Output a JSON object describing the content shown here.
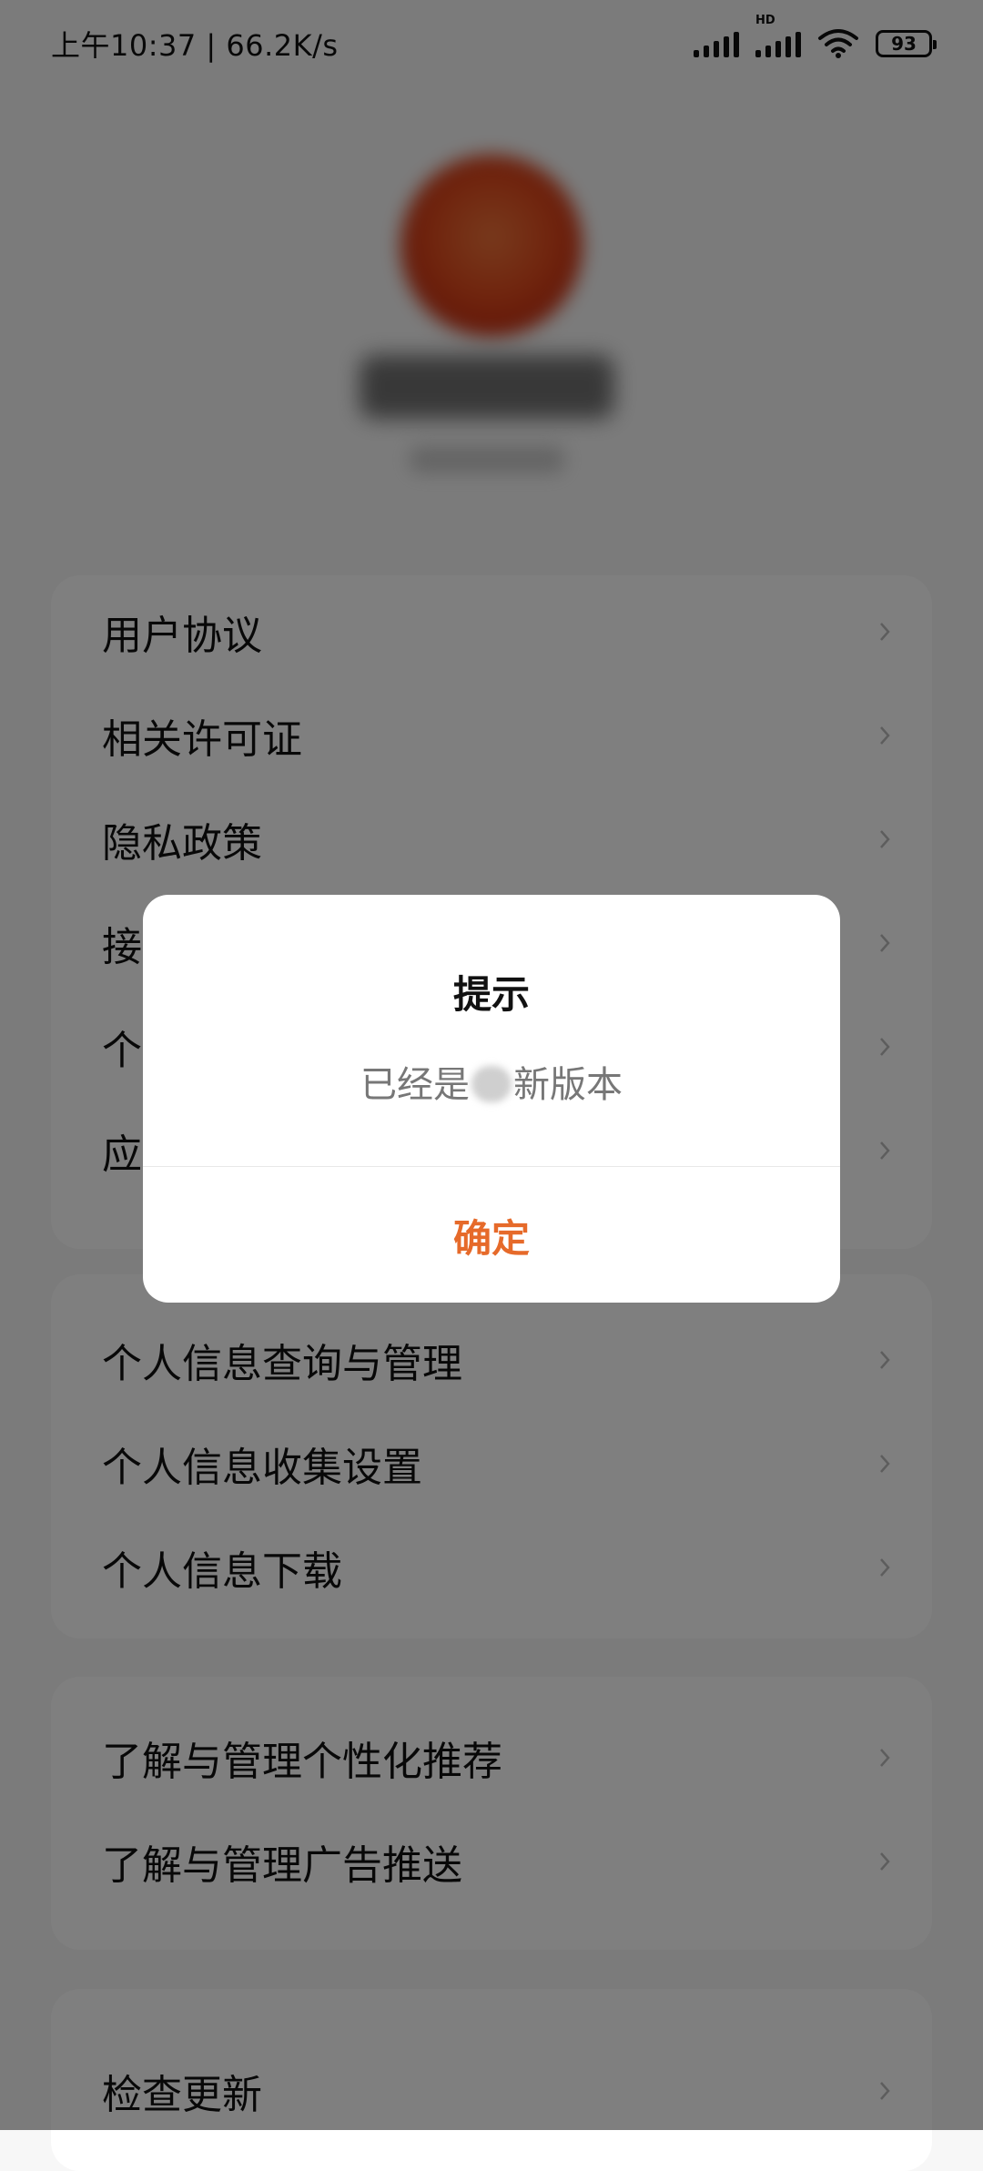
{
  "status_bar": {
    "time_speed": "上午10:37 | 66.2K/s",
    "hd_label": "HD",
    "battery": "93"
  },
  "menu": {
    "group1": [
      "用户协议",
      "相关许可证",
      "隐私政策",
      "接",
      "个",
      "应"
    ],
    "group2": [
      "个人信息查询与管理",
      "个人信息收集设置",
      "个人信息下载"
    ],
    "group3": [
      "了解与管理个性化推荐",
      "了解与管理广告推送"
    ],
    "group4": [
      "检查更新"
    ]
  },
  "dialog": {
    "title": "提示",
    "message_before": "已经是",
    "message_after": "新版本",
    "confirm": "确定"
  },
  "colors": {
    "accent": "#e66a2a",
    "overlay": "rgba(0,0,0,0.5)"
  },
  "icons": [
    "signal-icon",
    "hd-signal-icon",
    "wifi-icon",
    "battery-icon",
    "chevron-right-icon"
  ]
}
